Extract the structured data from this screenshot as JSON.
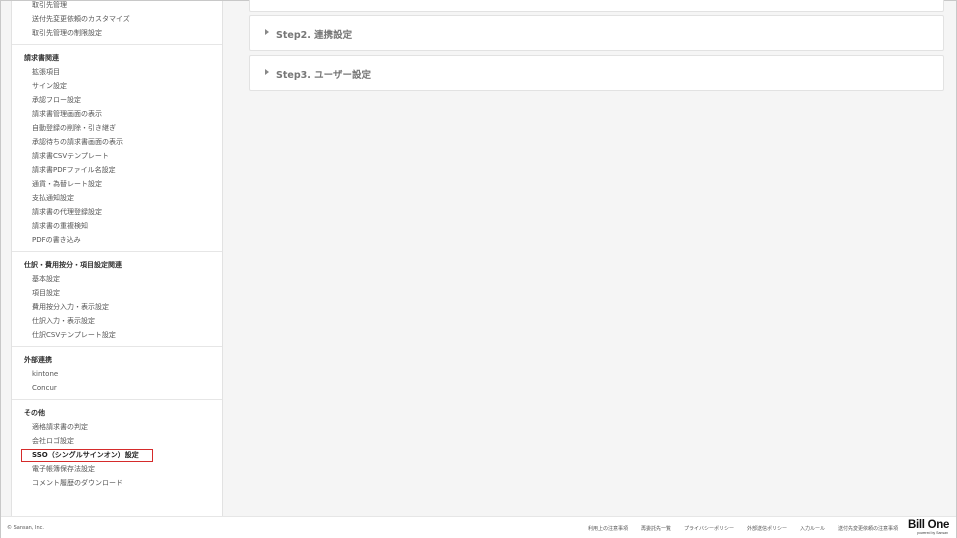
{
  "sidebar": {
    "top_items": [
      "取引先管理",
      "送付先変更依頼のカスタマイズ",
      "取引先管理の制限設定"
    ],
    "sections": [
      {
        "title": "請求書関連",
        "items": [
          "拡張項目",
          "サイン設定",
          "承認フロー設定",
          "請求書管理画面の表示",
          "自動登録の削除・引き継ぎ",
          "承認待ちの請求書画面の表示",
          "請求書CSVテンプレート",
          "請求書PDFファイル名設定",
          "通貨・為替レート設定",
          "支払通知設定",
          "請求書の代理登録設定",
          "請求書の重複検知",
          "PDFの書き込み"
        ]
      },
      {
        "title": "仕訳・費用按分・項目設定関連",
        "items": [
          "基本設定",
          "項目設定",
          "費用按分入力・表示設定",
          "仕訳入力・表示設定",
          "仕訳CSVテンプレート設定"
        ]
      },
      {
        "title": "外部連携",
        "items": [
          "kintone",
          "Concur"
        ]
      },
      {
        "title": "その他",
        "items": [
          "適格請求書の判定",
          "会社ロゴ設定",
          "SSO（シングルサインオン）設定",
          "電子帳簿保存法設定",
          "コメント履歴のダウンロード"
        ],
        "active_index": 2
      }
    ]
  },
  "main": {
    "steps": [
      {
        "label": "Step2. 連携設定"
      },
      {
        "label": "Step3. ユーザー設定"
      }
    ]
  },
  "footer": {
    "copyright": "© Sansan, Inc.",
    "links": [
      "利用上の注意事項",
      "再委託先一覧",
      "プライバシーポリシー",
      "外部送信ポリシー",
      "入力ルール",
      "送付先変更依頼の注意事項"
    ],
    "logo_main": "Bill One",
    "logo_sub": "powered by Sansan"
  },
  "colors": {
    "active_border": "#d52b2b",
    "background": "#f5f5f5",
    "panel": "#ffffff"
  },
  "icons": [
    "chevron-right-icon"
  ]
}
